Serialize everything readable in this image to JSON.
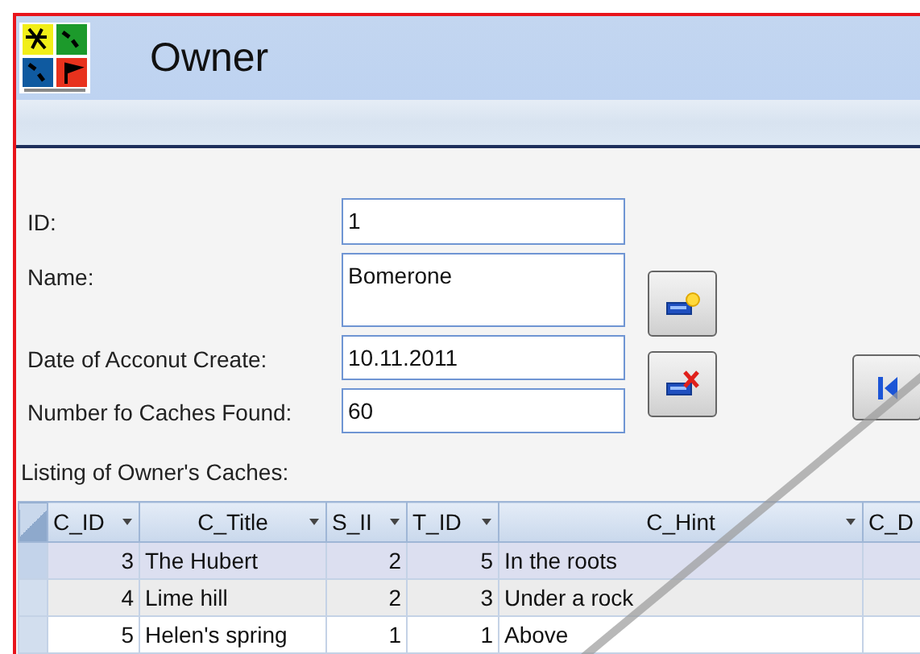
{
  "window": {
    "title": "Owner"
  },
  "fields": [
    {
      "label": "ID:",
      "value": "1",
      "kind": "single"
    },
    {
      "label": "Name:",
      "value": "Bomerone",
      "kind": "multi"
    },
    {
      "label": "Date of Acconut Create:",
      "value": "10.11.2011",
      "kind": "single"
    },
    {
      "label": "Number fo Caches Found:",
      "value": "60",
      "kind": "single"
    }
  ],
  "record_buttons": [
    {
      "kind": "new"
    },
    {
      "kind": "delete"
    }
  ],
  "nav_buttons": [
    {
      "kind": "first"
    }
  ],
  "subform": {
    "label": "Listing of Owner's Caches:",
    "columns": [
      {
        "label": "C_ID",
        "kind": "number",
        "sort_menu": true
      },
      {
        "label": "C_Title",
        "kind": "text",
        "sort_menu": true
      },
      {
        "label": "S_II",
        "kind": "number",
        "sort_menu": true
      },
      {
        "label": "T_ID",
        "kind": "number",
        "sort_menu": true
      },
      {
        "label": "C_Hint",
        "kind": "text",
        "sort_menu": true
      },
      {
        "label": "C_D",
        "kind": "text",
        "sort_menu": false
      }
    ],
    "rows": [
      {
        "cells": [
          "3",
          "The Hubert",
          "2",
          "5",
          "In the roots"
        ],
        "selected": true
      },
      {
        "cells": [
          "4",
          "Lime hill",
          "2",
          "3",
          "Under a rock"
        ],
        "selected": false
      },
      {
        "cells": [
          "5",
          "Helen's spring",
          "1",
          "1",
          "Above"
        ],
        "selected": false
      }
    ]
  }
}
